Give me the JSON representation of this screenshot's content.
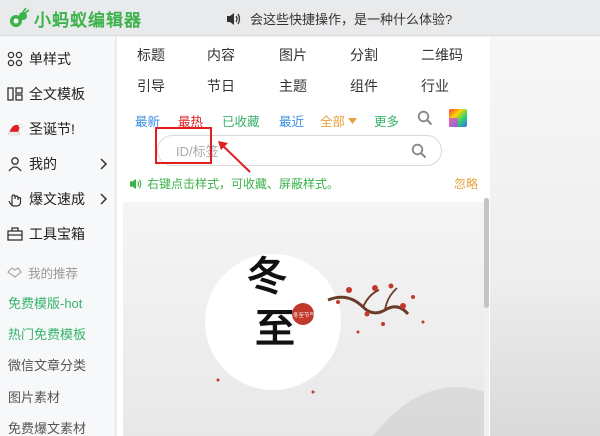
{
  "header": {
    "logo_text": "小蚂蚁编辑器",
    "notice": "会这些快捷操作，是一种什么体验?"
  },
  "sidebar": {
    "items": [
      {
        "label": "单样式",
        "icon": "grid-icon",
        "has_chevron": false
      },
      {
        "label": "全文模板",
        "icon": "template-icon",
        "has_chevron": false
      },
      {
        "label": "圣诞节!",
        "icon": "santa-hat-icon",
        "has_chevron": false
      },
      {
        "label": "我的",
        "icon": "user-icon",
        "has_chevron": true
      },
      {
        "label": "爆文速成",
        "icon": "hand-icon",
        "has_chevron": true
      },
      {
        "label": "工具宝箱",
        "icon": "toolbox-icon",
        "has_chevron": false
      }
    ],
    "recommend_head": "我的推荐",
    "recommend_items": [
      {
        "label": "免费模版-hot",
        "green": true
      },
      {
        "label": "热门免费模板",
        "green": true
      },
      {
        "label": "微信文章分类",
        "green": false
      },
      {
        "label": "图片素材",
        "green": false
      },
      {
        "label": "免费爆文素材",
        "green": false
      }
    ]
  },
  "categories": {
    "row1": [
      "标题",
      "内容",
      "图片",
      "分割",
      "二维码"
    ],
    "row2": [
      "引导",
      "节日",
      "主题",
      "组件",
      "行业"
    ]
  },
  "filters": [
    {
      "label": "最新",
      "color": "#3a8ee6"
    },
    {
      "label": "最热",
      "color": "#e02020"
    },
    {
      "label": "已收藏",
      "color": "#37b36a"
    },
    {
      "label": "最近",
      "color": "#3a8ee6"
    },
    {
      "label": "全部",
      "color": "#e6a23c"
    },
    {
      "label": "更多",
      "color": "#37b36a"
    }
  ],
  "search": {
    "placeholder": "ID/标签"
  },
  "tip": {
    "text": "右键点击样式，可收藏、屏蔽样式。",
    "ignore": "忽略"
  },
  "preview": {
    "title_line1": "冬",
    "title_line2": "至",
    "seal": "冬至节气"
  },
  "colors": {
    "brand": "#3cb24a",
    "accent_red": "#e02020"
  }
}
